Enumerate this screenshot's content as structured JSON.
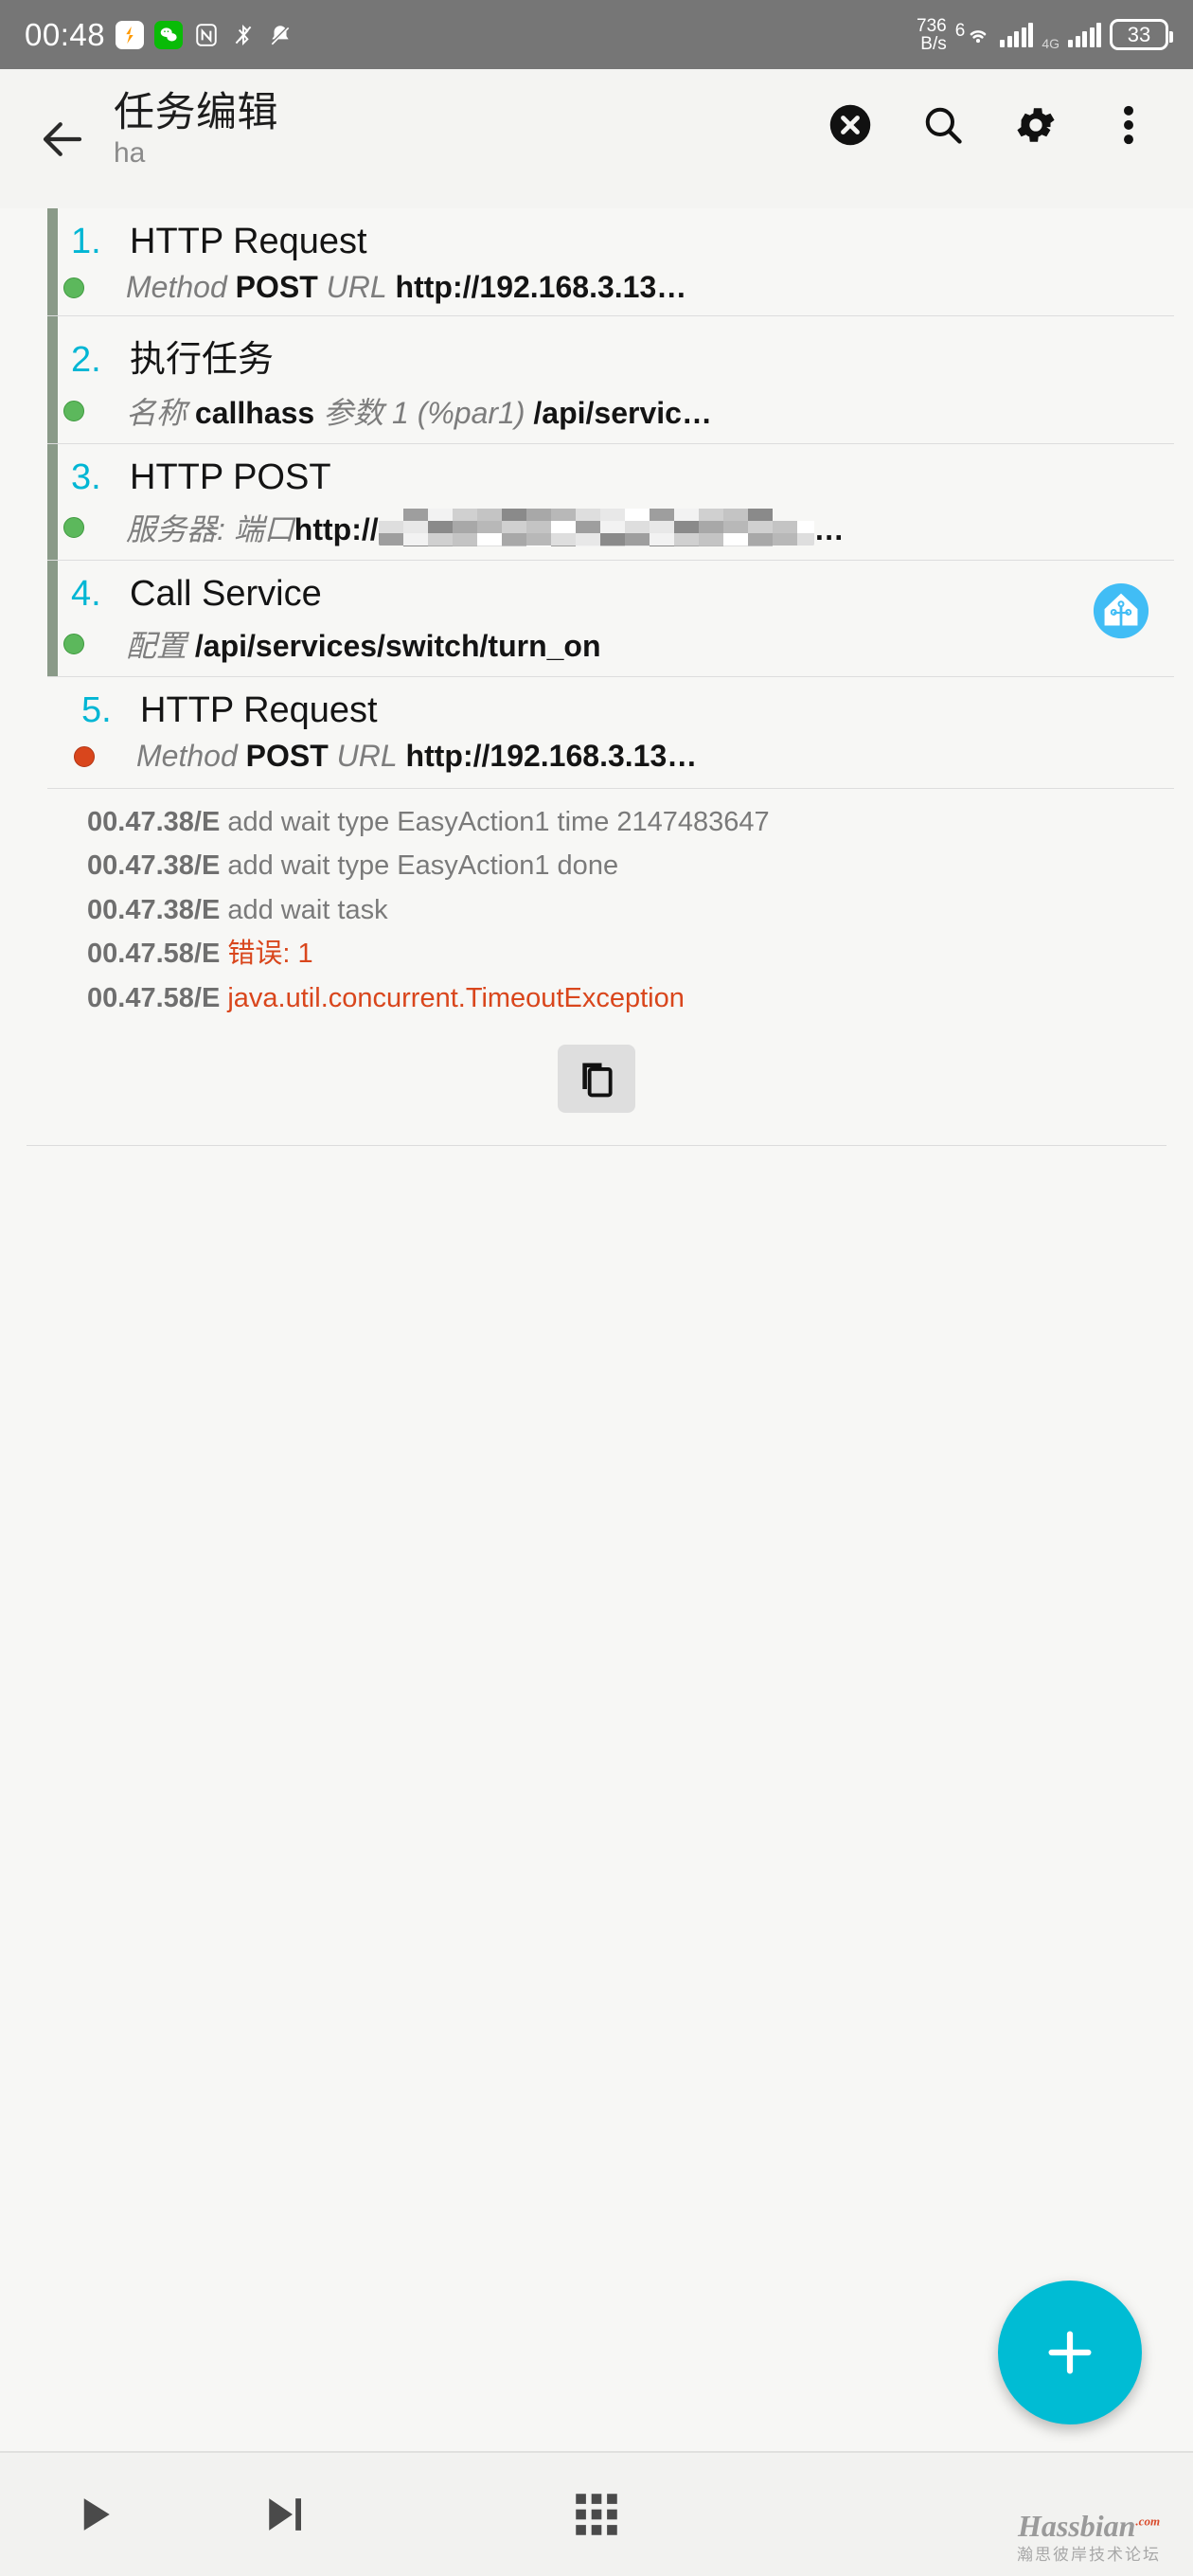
{
  "statusbar": {
    "clock": "00:48",
    "icons": [
      "alipay-icon",
      "wechat-icon",
      "nfc-icon",
      "bluetooth-off-icon",
      "notifications-muted-icon"
    ],
    "net_speed_value": "736",
    "net_speed_unit": "B/s",
    "wifi_label": "6",
    "signal_label": "4G",
    "battery": "33"
  },
  "appbar": {
    "back_icon": "arrow-back-icon",
    "title": "任务编辑",
    "subtitle": "ha",
    "actions": [
      {
        "name": "stop-button",
        "icon": "close-circle-icon"
      },
      {
        "name": "search-button",
        "icon": "search-icon"
      },
      {
        "name": "settings-button",
        "icon": "gear-icon"
      },
      {
        "name": "overflow-button",
        "icon": "more-vertical-icon"
      }
    ]
  },
  "actions": [
    {
      "num": "1.",
      "name": "HTTP Request",
      "status": "green",
      "has_bar": true,
      "badge": null,
      "params": [
        {
          "label": "Method",
          "value": "POST"
        },
        {
          "label": "URL",
          "value": "http://192.168.3.13…"
        }
      ]
    },
    {
      "num": "2.",
      "name": "执行任务",
      "status": "green",
      "has_bar": true,
      "badge": null,
      "params": [
        {
          "label": "名称",
          "value": "callhass"
        },
        {
          "label": "参数 1 (%par1)",
          "value": "/api/servic…"
        }
      ]
    },
    {
      "num": "3.",
      "name": "HTTP POST",
      "status": "green",
      "has_bar": true,
      "badge": null,
      "redacted": true,
      "params": [
        {
          "label": "服务器: 端口",
          "value": "http://"
        }
      ],
      "trailing": "…"
    },
    {
      "num": "4.",
      "name": "Call Service",
      "status": "green",
      "has_bar": true,
      "badge": "home-assistant-icon",
      "params": [
        {
          "label": "配置",
          "value": "/api/services/switch/turn_on"
        }
      ]
    },
    {
      "num": "5.",
      "name": "HTTP Request",
      "status": "red",
      "has_bar": false,
      "badge": null,
      "params": [
        {
          "label": "Method",
          "value": "POST"
        },
        {
          "label": "URL",
          "value": "http://192.168.3.13…"
        }
      ]
    }
  ],
  "log": {
    "lines": [
      {
        "ts": "00.47.38/E",
        "msg": "add wait type EasyAction1 time 2147483647",
        "error": false
      },
      {
        "ts": "00.47.38/E",
        "msg": "add wait type EasyAction1 done",
        "error": false
      },
      {
        "ts": "00.47.38/E",
        "msg": "add wait task",
        "error": false
      },
      {
        "ts": "00.47.58/E",
        "msg": "错误: 1",
        "error": true
      },
      {
        "ts": "00.47.58/E",
        "msg": "java.util.concurrent.TimeoutException",
        "error": true
      }
    ],
    "copy_icon": "copy-icon"
  },
  "fab": {
    "icon": "plus-icon",
    "color": "#00bcd4"
  },
  "bottombar": {
    "buttons": [
      {
        "name": "run-button",
        "icon": "play-icon"
      },
      {
        "name": "step-button",
        "icon": "step-forward-icon"
      },
      {
        "name": "grid-button",
        "icon": "grid-icon"
      }
    ]
  },
  "watermark": {
    "main": "Hassbian",
    "sub": "瀚思彼岸技术论坛",
    "tld": ".com"
  }
}
